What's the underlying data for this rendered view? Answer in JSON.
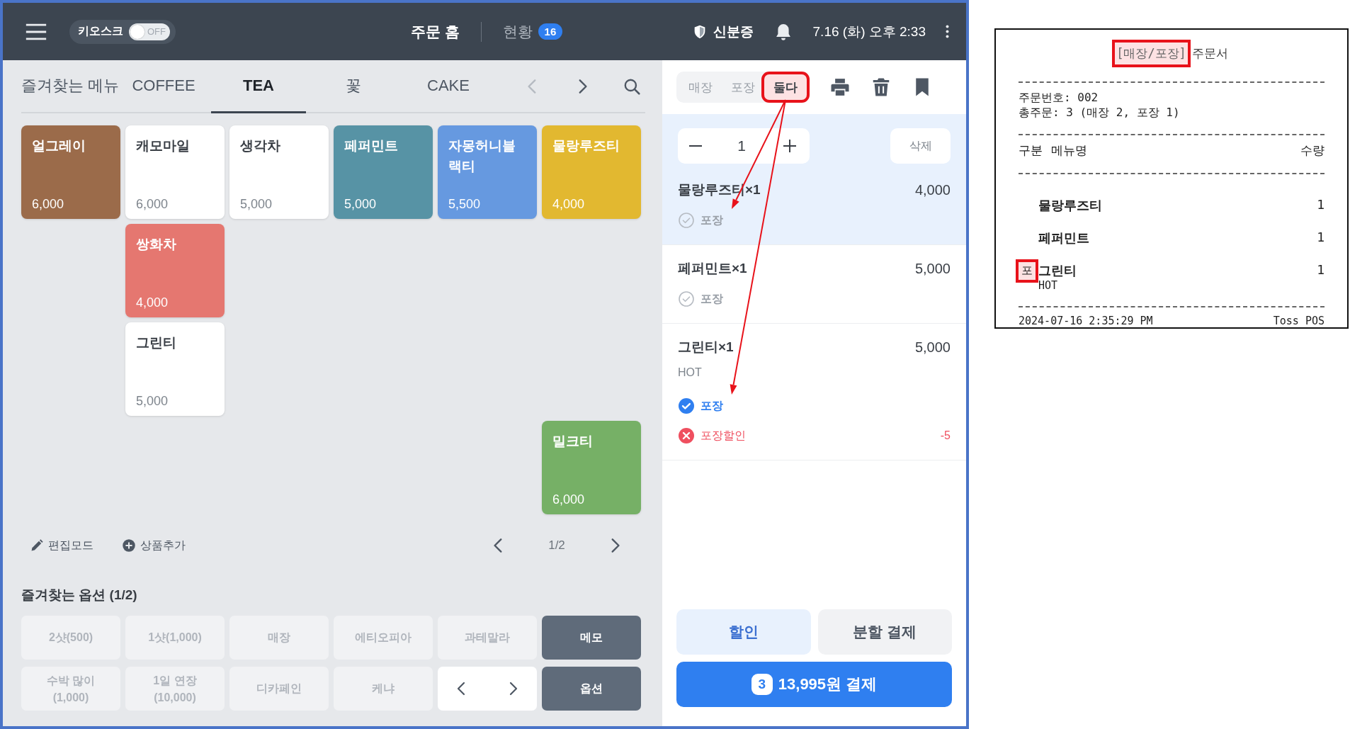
{
  "topbar": {
    "kiosk": {
      "label": "키오스크",
      "state": "OFF",
      "on": false
    },
    "nav": [
      {
        "label": "주문 홈",
        "selected": true
      },
      {
        "label": "현황",
        "selected": false,
        "badge": "16"
      }
    ],
    "id_label": "신분증",
    "datetime": "7.16 (화) 오후 2:33"
  },
  "menu_tabs": [
    {
      "label": "즐겨찾는 메뉴",
      "selected": false
    },
    {
      "label": "COFFEE",
      "selected": false
    },
    {
      "label": "TEA",
      "selected": true
    },
    {
      "label": "꽃",
      "selected": false
    },
    {
      "label": "CAKE",
      "selected": false
    }
  ],
  "menu_arrows": [
    {
      "kind": "prev",
      "disabled": true
    },
    {
      "kind": "next",
      "disabled": false
    }
  ],
  "menu_grid": [
    [
      {
        "kind": "item",
        "name": "얼그레이",
        "price": "6,000",
        "color": "#9b6b4a"
      },
      {
        "kind": "item",
        "name": "캐모마일",
        "price": "6,000",
        "color": "#ffffff"
      },
      {
        "kind": "item",
        "name": "생각차",
        "price": "5,000",
        "color": "#ffffff"
      },
      {
        "kind": "item",
        "name": "페퍼민트",
        "price": "5,000",
        "color": "#5793a5"
      },
      {
        "kind": "item",
        "name": "자몽허니블랙티",
        "price": "5,500",
        "color": "#6699e0"
      },
      {
        "kind": "item",
        "name": "물랑루즈티",
        "price": "4,000",
        "color": "#e2b830"
      }
    ],
    [
      {
        "kind": "empty"
      },
      {
        "kind": "item",
        "name": "쌍화차",
        "price": "4,000",
        "color": "#e57770"
      },
      {
        "kind": "empty"
      },
      {
        "kind": "empty"
      },
      {
        "kind": "empty"
      },
      {
        "kind": "empty"
      }
    ],
    [
      {
        "kind": "empty"
      },
      {
        "kind": "item",
        "name": "그린티",
        "price": "5,000",
        "color": "#ffffff"
      },
      {
        "kind": "empty"
      },
      {
        "kind": "empty"
      },
      {
        "kind": "empty"
      },
      {
        "kind": "empty"
      }
    ],
    [
      {
        "kind": "empty"
      },
      {
        "kind": "empty"
      },
      {
        "kind": "empty"
      },
      {
        "kind": "empty"
      },
      {
        "kind": "empty"
      },
      {
        "kind": "item",
        "name": "밀크티",
        "price": "6,000",
        "color": "#76b066"
      }
    ]
  ],
  "menu_toolbar": {
    "edit_mode": "편집모드",
    "add_item": "상품추가",
    "page": "1/2"
  },
  "options": {
    "title": "즐겨찾는 옵션 (1/2)",
    "rows": [
      [
        {
          "kind": "option",
          "label": "2샷(500)"
        },
        {
          "kind": "option",
          "label": "1샷(1,000)"
        },
        {
          "kind": "option",
          "label": "매장"
        },
        {
          "kind": "option",
          "label": "에티오피아"
        },
        {
          "kind": "option",
          "label": "과테말라"
        },
        {
          "kind": "action",
          "label": "메모"
        }
      ],
      [
        {
          "kind": "option",
          "label": "수박 많이",
          "sub": "(1,000)"
        },
        {
          "kind": "option",
          "label": "1일 연장",
          "sub": "(10,000)"
        },
        {
          "kind": "option",
          "label": "디카페인"
        },
        {
          "kind": "option",
          "label": "케냐"
        },
        {
          "kind": "nav"
        },
        {
          "kind": "action",
          "label": "옵션"
        }
      ]
    ]
  },
  "order": {
    "modes": [
      {
        "label": "매장",
        "selected": false,
        "annotated": false
      },
      {
        "label": "포장",
        "selected": false,
        "annotated": false
      },
      {
        "label": "둘다",
        "selected": true,
        "annotated": true
      }
    ],
    "items": [
      {
        "name": "물랑루즈티×1",
        "price": "4,000",
        "selected": true,
        "quantity": "1",
        "delete": "삭제",
        "options": [
          {
            "kind": "check",
            "label": "포장",
            "checked": false,
            "arrow_target": true
          }
        ]
      },
      {
        "name": "페퍼민트×1",
        "price": "5,000",
        "selected": false,
        "options": [
          {
            "kind": "check",
            "label": "포장",
            "checked": false
          }
        ]
      },
      {
        "name": "그린티×1",
        "price": "5,000",
        "selected": false,
        "note": "HOT",
        "options": [
          {
            "kind": "check",
            "label": "포장",
            "checked": true,
            "arrow_target": true
          },
          {
            "kind": "discount",
            "label": "포장할인",
            "amount": "-5"
          }
        ]
      }
    ],
    "discount": "할인",
    "split": "분할 결제",
    "pay": {
      "count": "3",
      "label": "13,995원 결제"
    }
  },
  "receipt": {
    "title_tag": "[매장/포장]",
    "title_tag_annotated": true,
    "title": "주문서",
    "order_number": "주문번호: 002",
    "total": "총주문: 3 (매장 2, 포장 1)",
    "columns": [
      "구분",
      "메뉴명",
      "수량"
    ],
    "rows": [
      {
        "menu": "물랑루즈티",
        "qty": "1"
      },
      {
        "menu": "페퍼민트",
        "qty": "1"
      },
      {
        "type": "포",
        "type_annotated": true,
        "menu": "그린티",
        "option": "HOT",
        "qty": "1"
      }
    ],
    "printed_at": "2024-07-16 2:35:29 PM",
    "printer": "Toss POS"
  }
}
